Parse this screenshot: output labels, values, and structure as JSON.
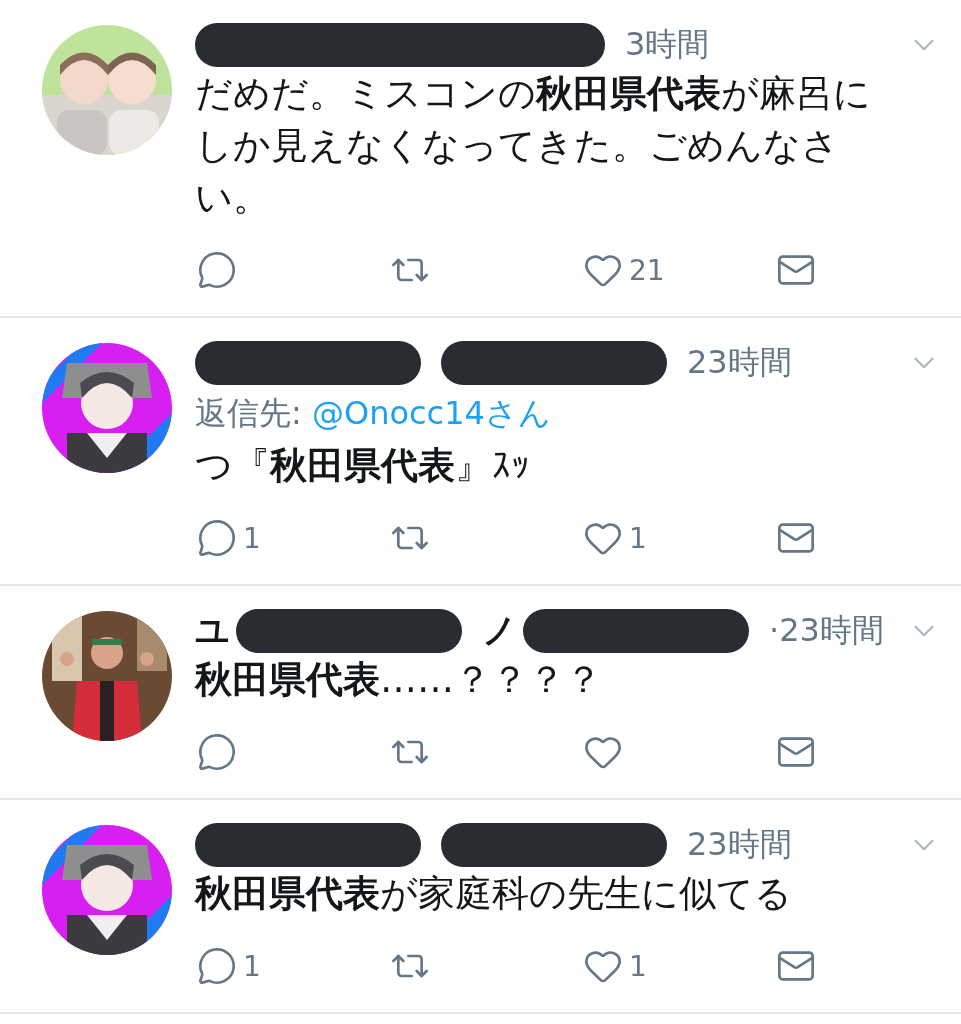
{
  "tweets": [
    {
      "avatar": {
        "kind": "picture"
      },
      "header": [
        {
          "kind": "redacted"
        }
      ],
      "time": "3時間",
      "text": "だめだ。ミスコンの**秋田県代表**が麻呂にしか見えなくなってきた。ごめんなさい。",
      "actions": [
        {
          "kind": "reply"
        },
        {
          "kind": "retweet"
        },
        {
          "kind": "like",
          "count": "21"
        },
        {
          "kind": "message"
        }
      ]
    },
    {
      "avatar": {
        "kind": "picture"
      },
      "header": [
        {
          "kind": "redacted"
        },
        {
          "kind": "redacted"
        }
      ],
      "time": "23時間",
      "reply_to": {
        "label": "返信先:",
        "handle": "@Onocc14さん"
      },
      "text": "つ『**秋田県代表**』ｽｯ",
      "actions": [
        {
          "kind": "reply",
          "count": "1"
        },
        {
          "kind": "retweet"
        },
        {
          "kind": "like",
          "count": "1"
        },
        {
          "kind": "message"
        }
      ]
    },
    {
      "avatar": {
        "kind": "picture"
      },
      "header": [
        {
          "kind": "text",
          "text": "ユ"
        },
        {
          "kind": "redacted"
        },
        {
          "kind": "text",
          "text": "ノ"
        },
        {
          "kind": "redacted"
        }
      ],
      "time": "·23時間",
      "text": "**秋田県代表**……？？？？",
      "actions": [
        {
          "kind": "reply"
        },
        {
          "kind": "retweet"
        },
        {
          "kind": "like"
        },
        {
          "kind": "message"
        }
      ]
    },
    {
      "avatar": {
        "kind": "picture"
      },
      "header": [
        {
          "kind": "redacted"
        },
        {
          "kind": "redacted"
        }
      ],
      "time": "23時間",
      "text": "**秋田県代表**が家庭科の先生に似てる",
      "actions": [
        {
          "kind": "reply",
          "count": "1"
        },
        {
          "kind": "retweet"
        },
        {
          "kind": "like",
          "count": "1"
        },
        {
          "kind": "message"
        }
      ]
    }
  ]
}
